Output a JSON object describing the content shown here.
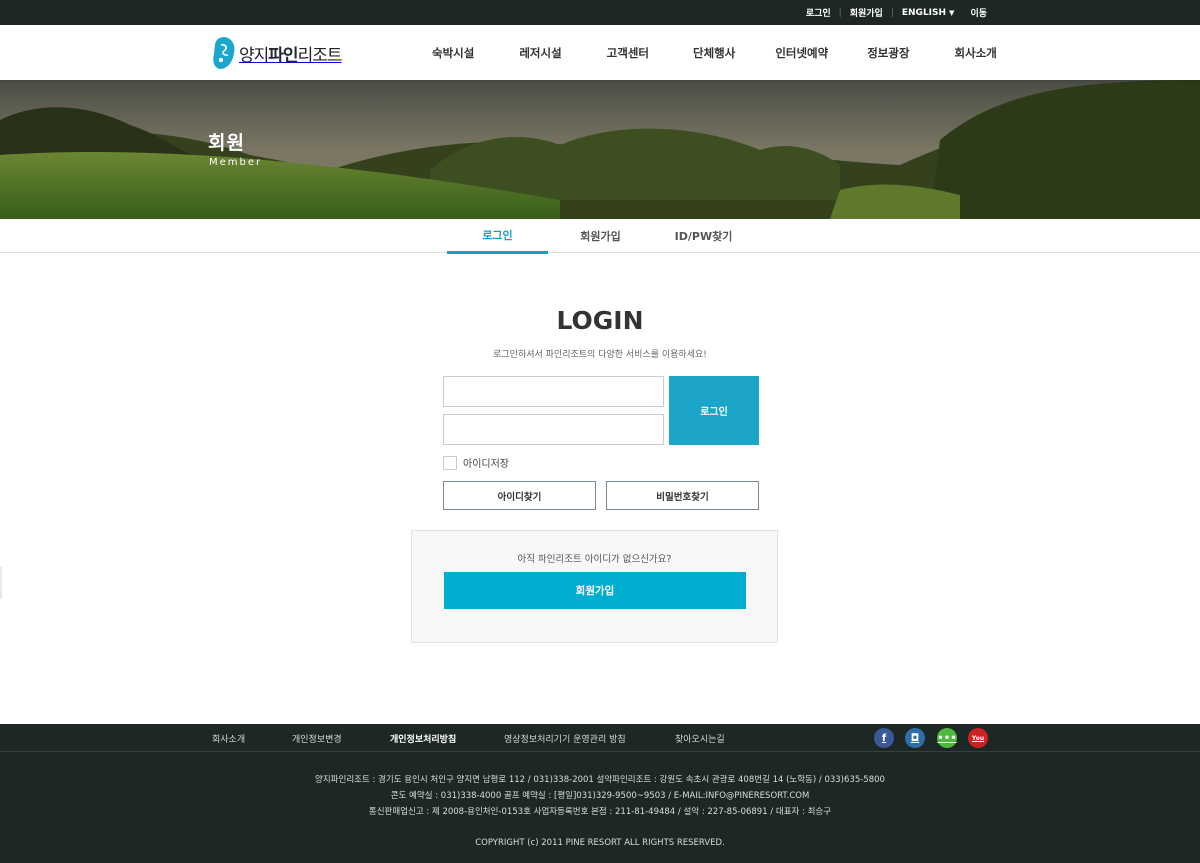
{
  "topbar": {
    "login": "로그인",
    "join": "회원가입",
    "language": "ENGLISH",
    "move": "이동"
  },
  "header": {
    "logo_prefix": "양지",
    "logo_bold": "파인",
    "logo_suffix": "리조트",
    "nav": [
      "숙박시설",
      "레저시설",
      "고객센터",
      "단체행사",
      "인터넷예약",
      "정보광장",
      "회사소개"
    ]
  },
  "hero": {
    "title": "회원",
    "subtitle": "Member"
  },
  "tabs": [
    "로그인",
    "회원가입",
    "ID/PW찾기"
  ],
  "login": {
    "title": "LOGIN",
    "description": "로그인하셔서 파인리조트의 다양한 서비스를 이용하세요!",
    "id_value": "",
    "pw_value": "",
    "submit_label": "로그인",
    "remember_label": "아이디저장",
    "find_id_label": "아이디찾기",
    "find_pw_label": "비밀번호찾기",
    "join_question": "아직 파인리조트 아이디가 없으신가요?",
    "join_label": "회원가입"
  },
  "footer": {
    "links": [
      "회사소개",
      "개인정보변경",
      "개인정보처리방침",
      "영상정보처리기기 운영관리 방침",
      "찾아오시는길"
    ],
    "social": [
      {
        "icon": "facebook-icon",
        "glyph": "f"
      },
      {
        "icon": "instagram-icon",
        "glyph": "◘"
      },
      {
        "icon": "talk-icon",
        "glyph": "•••"
      },
      {
        "icon": "youtube-icon",
        "glyph": "You"
      }
    ],
    "line1": "양지파인리조트 : 경기도 용인시 처인구 양지면 남평로 112 / 031)338-2001     설악파인리조트 : 강원도 속초시 관광로 408번길 14 (노학동) / 033)635-5800",
    "line2": "콘도 예약실 : 031)338-4000     골프 예약실 : [평일]031)329-9500~9503 / E-MAIL:INFO@PINERESORT.COM",
    "line3": "통신판매업신고 : 제 2008-용인처인-0153호    사업자등록번호 본점 : 211-81-49484 / 설악 : 227-85-06891 / 대표자 : 최승구",
    "copyright": "COPYRIGHT (c) 2011 PINE RESORT ALL RIGHTS RESERVED."
  },
  "colors": {
    "accent": "#1ca4c9",
    "join_button": "#00aecf",
    "dark_bar": "#1d2826"
  }
}
